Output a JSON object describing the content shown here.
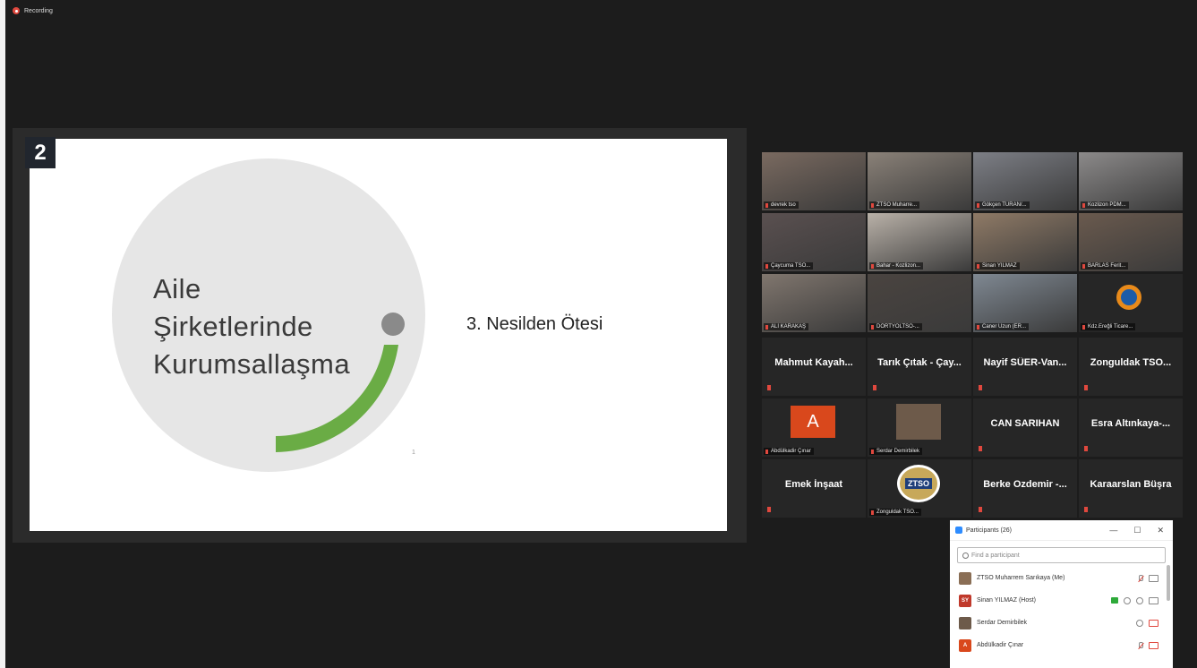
{
  "recording": {
    "label": "Recording"
  },
  "slide": {
    "number": "2",
    "title_lines": [
      "Aile",
      "Şirketlerinde",
      "Kurumsallaşma"
    ],
    "subtitle": "3. Nesilden Ötesi",
    "footnote": "1"
  },
  "gallery": {
    "video_tiles": [
      {
        "label": "devrek tso",
        "scene": "#7a6a60"
      },
      {
        "label": "ZTSO Muharre...",
        "scene": "#8a8178"
      },
      {
        "label": "Gökçen TURAN/...",
        "scene": "#7d7f86"
      },
      {
        "label": "Kozlizon PDM...",
        "scene": "#8c8a8a"
      },
      {
        "label": "Çaycuma TSO...",
        "scene": "#5a5050"
      },
      {
        "label": "Bahar - Kozlizon...",
        "scene": "#b9b1a8"
      },
      {
        "label": "Sinan YILMAZ",
        "scene": "#8f7a66"
      },
      {
        "label": "BARLAS Ferit...",
        "scene": "#6a5a4e"
      },
      {
        "label": "ALİ KARAKAŞ",
        "scene": "#80766e"
      },
      {
        "label": "DÖRTYOLTSO-...",
        "scene": "#4a4440"
      },
      {
        "label": "Caner Uzun (ER...",
        "scene": "#7f8892"
      },
      {
        "label": "Kdz.Ereğli Ticare...",
        "scene": "#262626"
      }
    ],
    "name_tiles": [
      "Mahmut Kayah...",
      "Tarık Çıtak - Çay...",
      "Nayif SÜER-Van...",
      "Zonguldak TSO...",
      "",
      "",
      "CAN SARIHAN",
      "Esra Altınkaya-...",
      "Emek İnşaat",
      "",
      "Berke Ozdemir -...",
      "Karaarslan Büşra"
    ],
    "abdulkadir_label": "Abdülkadir Çınar",
    "abdulkadir_initial": "A",
    "serdar_label": "Serdar Demirbilek",
    "zonguldak_label": "Zonguldak TSO...",
    "ztso_logo_text": "ZTSO"
  },
  "participants": {
    "title": "Participants (26)",
    "minimize": "—",
    "maximize": "☐",
    "close": "✕",
    "search_placeholder": "Find a participant",
    "rows": [
      {
        "name": "ZTSO Muharrem Sarıkaya (Me)",
        "initials": "",
        "color": "#8a6e55"
      },
      {
        "name": "Sinan YILMAZ (Host)",
        "initials": "SY",
        "color": "#c0392b"
      },
      {
        "name": "Serdar Demirbilek",
        "initials": "",
        "color": "#6d5a4a"
      },
      {
        "name": "Abdülkadir Çınar",
        "initials": "A",
        "color": "#d9481c"
      }
    ]
  },
  "colors": {
    "accent_green": "#6aac45",
    "gray_dot": "#8a8a8a",
    "circle_fill": "#e6e6e6"
  }
}
